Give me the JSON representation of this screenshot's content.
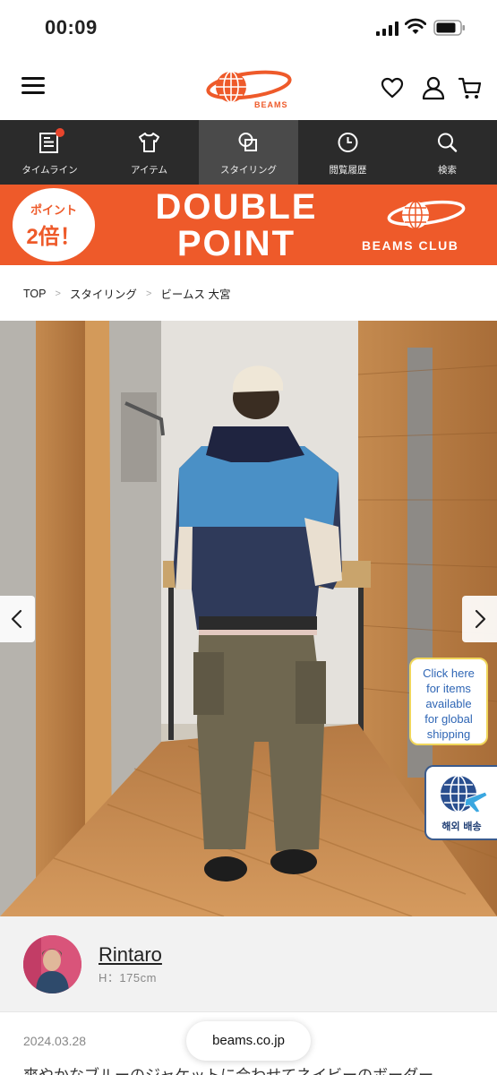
{
  "status_bar": {
    "time": "00:09"
  },
  "header": {
    "logo_text": "BEAMS"
  },
  "nav": {
    "items": [
      {
        "label": "タイムライン"
      },
      {
        "label": "アイテム"
      },
      {
        "label": "スタイリング"
      },
      {
        "label": "閲覧履歴"
      },
      {
        "label": "検索"
      }
    ],
    "active_index": 2
  },
  "banner": {
    "circle_line1": "ポイント",
    "circle_line2": "2倍！",
    "title_line1": "DOUBLE",
    "title_line2": "POINT",
    "club_label": "BEAMS CLUB",
    "bg_color": "#ee5a2a"
  },
  "breadcrumb": {
    "items": [
      "TOP",
      "スタイリング",
      "ビームス 大宮"
    ],
    "separator": ">"
  },
  "photo": {
    "global_bubble": [
      "Click here",
      "for items",
      "available",
      "for global",
      "shipping"
    ],
    "ship_label": "해외 배송"
  },
  "staff": {
    "name": "Rintaro",
    "height": "H：175cm"
  },
  "post": {
    "date": "2024.03.28",
    "description": "爽やかなブルーのジャケットに合わせてネイビーのボーダー"
  },
  "browser": {
    "url": "beams.co.jp"
  },
  "colors": {
    "accent": "#ee5a2a",
    "nav_bg": "#2b2b2b",
    "link_blue": "#2f66b5"
  }
}
